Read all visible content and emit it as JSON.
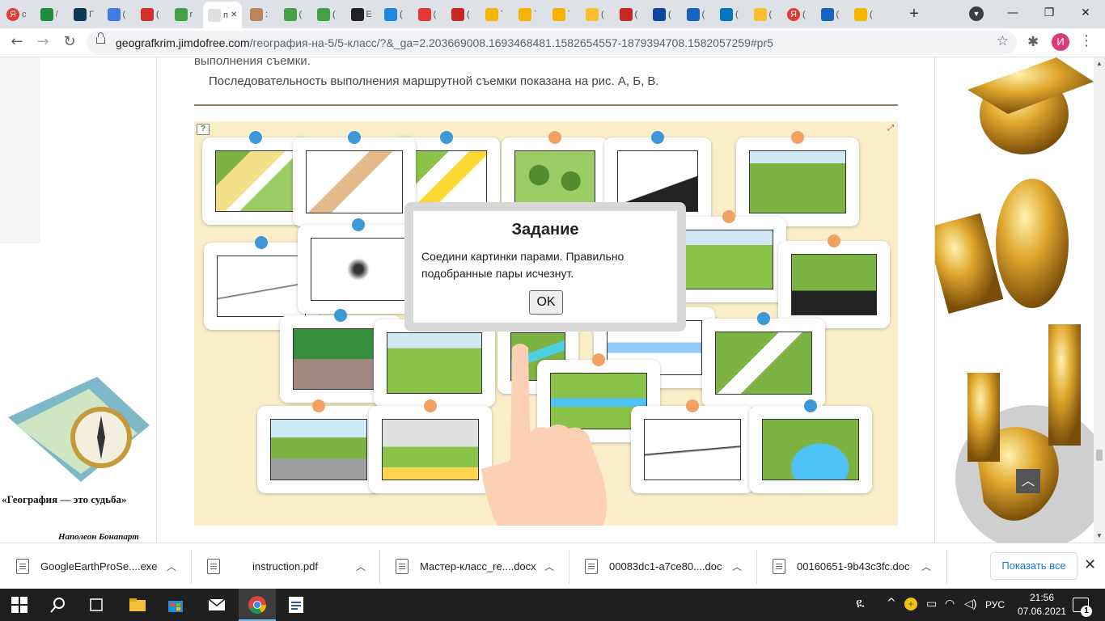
{
  "browser": {
    "tabs": [
      {
        "icon": "yandex-icon",
        "color": "#e53935",
        "text": "Я",
        "label": "с"
      },
      {
        "icon": "green-doc-icon",
        "color": "#1e8e3e",
        "text": "",
        "label": "/"
      },
      {
        "icon": "camera-icon",
        "color": "#0b3954",
        "text": "",
        "label": "Г"
      },
      {
        "icon": "blue-circle-icon",
        "color": "#3f7ae6",
        "text": "",
        "label": "("
      },
      {
        "icon": "news-icon",
        "color": "#d32f2f",
        "text": "",
        "label": "("
      },
      {
        "icon": "q-green-icon",
        "color": "#43a047",
        "text": "",
        "label": "r"
      },
      {
        "icon": "active-tab-icon",
        "color": "#e0e0e0",
        "text": "",
        "label": "п",
        "active": true
      },
      {
        "icon": "map-icon",
        "color": "#b8865b",
        "text": "",
        "label": ":"
      },
      {
        "icon": "q-green-icon",
        "color": "#43a047",
        "text": "",
        "label": "("
      },
      {
        "icon": "q-green-icon",
        "color": "#43a047",
        "text": "",
        "label": "("
      },
      {
        "icon": "s-icon",
        "color": "#222222",
        "text": "",
        "label": "E"
      },
      {
        "icon": "edge-icon",
        "color": "#1e88e5",
        "text": "",
        "label": "("
      },
      {
        "icon": "red-ie-icon",
        "color": "#e53935",
        "text": "",
        "label": "("
      },
      {
        "icon": "b-icon",
        "color": "#c62828",
        "text": "",
        "label": "("
      },
      {
        "icon": "yellow-icon",
        "color": "#f4b400",
        "text": "",
        "label": "`"
      },
      {
        "icon": "yellow-icon",
        "color": "#f4b400",
        "text": "",
        "label": "`"
      },
      {
        "icon": "yellow-icon",
        "color": "#f4b400",
        "text": "",
        "label": "`"
      },
      {
        "icon": "i-icon",
        "color": "#fbc02d",
        "text": "",
        "label": "("
      },
      {
        "icon": "presentation-icon",
        "color": "#c62828",
        "text": "",
        "label": "("
      },
      {
        "icon": "m-icon",
        "color": "#0d47a1",
        "text": "",
        "label": "("
      },
      {
        "icon": "book-icon",
        "color": "#1565c0",
        "text": "",
        "label": "("
      },
      {
        "icon": "check-icon",
        "color": "#0277bd",
        "text": "",
        "label": "("
      },
      {
        "icon": "i-icon",
        "color": "#fbc02d",
        "text": "",
        "label": "("
      },
      {
        "icon": "yandex-icon",
        "color": "#e53935",
        "text": "Я",
        "label": "("
      },
      {
        "icon": "monitor-icon",
        "color": "#1565c0",
        "text": "",
        "label": "("
      },
      {
        "icon": "picture-icon",
        "color": "#f4b400",
        "text": "",
        "label": "("
      }
    ],
    "new_tab": "+",
    "url_host": "geografkrim.jimdofree.com",
    "url_path": "/география-на-5/5-класс/?&_ga=2.203669008.1693468481.1582654557-1879394708.1582057259#pr5",
    "profile_initial": "И"
  },
  "page": {
    "text_line1": "выполнения съемки.",
    "text_line2": "Последовательность выполнения маршрутной съемки показана на рис. А, Б, В.",
    "caption": "«География — это судьба»",
    "caption_author": "Наполеон Бонапарт"
  },
  "exercise": {
    "dialog_title": "Задание",
    "dialog_text": "Соедини картинки парами. Правильно подобранные пары исчезнут.",
    "ok_label": "OK",
    "dot_colors": {
      "blue": "#3c98d6",
      "orange": "#f3a063"
    },
    "background_color": "#fbefc9"
  },
  "downloads": {
    "items": [
      {
        "name": "GoogleEarthProSe....exe",
        "icon": "installer-icon"
      },
      {
        "name": "instruction.pdf",
        "icon": "pdf-icon"
      },
      {
        "name": "Мастер-класс_re....docx",
        "icon": "doc-icon"
      },
      {
        "name": "00083dc1-a7ce80....doc",
        "icon": "doc-icon"
      },
      {
        "name": "00160651-9b43c3fc.doc",
        "icon": "doc-icon"
      }
    ],
    "show_all": "Показать все"
  },
  "taskbar": {
    "lang": "РУС",
    "time": "21:56",
    "date": "07.06.2021",
    "notifications": "1"
  }
}
